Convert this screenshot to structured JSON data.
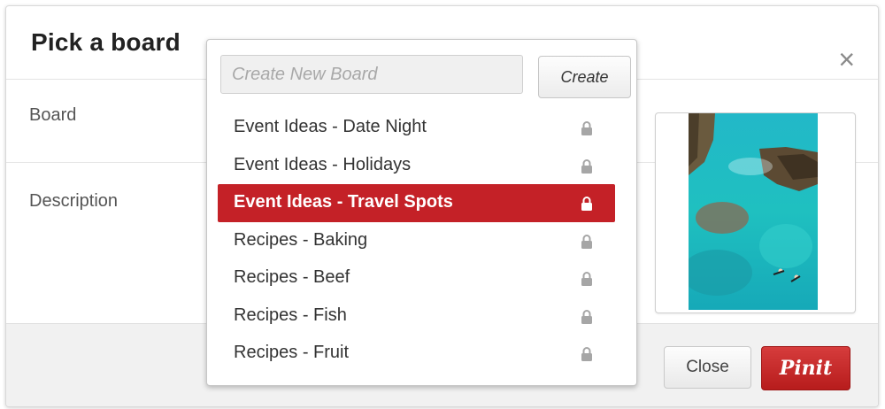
{
  "dialog": {
    "title": "Pick a board",
    "close_symbol": "×"
  },
  "fields": {
    "board_label": "Board",
    "description_label": "Description"
  },
  "dropdown": {
    "input_placeholder": "Create New Board",
    "input_value": "",
    "create_label": "Create",
    "items": [
      {
        "label": "Event Ideas - Date Night",
        "icon": "lock-icon",
        "selected": false
      },
      {
        "label": "Event Ideas - Holidays",
        "icon": "lock-icon",
        "selected": false
      },
      {
        "label": "Event Ideas - Travel Spots",
        "icon": "lock-icon",
        "selected": true
      },
      {
        "label": "Recipes - Baking",
        "icon": "lock-icon",
        "selected": false
      },
      {
        "label": "Recipes - Beef",
        "icon": "lock-icon",
        "selected": false
      },
      {
        "label": "Recipes - Fish",
        "icon": "lock-icon",
        "selected": false
      },
      {
        "label": "Recipes - Fruit",
        "icon": "lock-icon",
        "selected": false
      }
    ]
  },
  "footer": {
    "close_label": "Close",
    "pinit_label": "Pinit"
  },
  "colors": {
    "accent": "#c42127",
    "lock_gray": "#a6a6a6"
  }
}
